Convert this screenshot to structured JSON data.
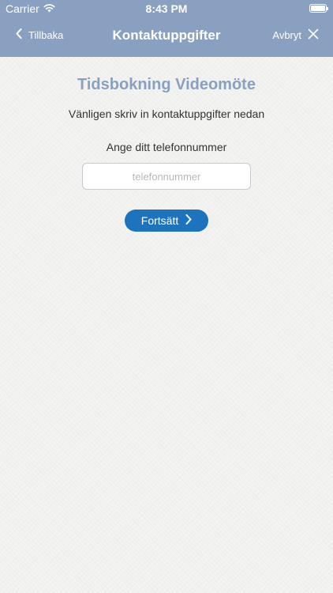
{
  "status_bar": {
    "carrier": "Carrier",
    "time": "8:43 PM",
    "battery_level": 1.0
  },
  "nav": {
    "back_label": "Tillbaka",
    "title": "Kontaktuppgifter",
    "cancel_label": "Avbryt"
  },
  "form": {
    "heading": "Tidsbokning Videomöte",
    "subtitle": "Vänligen skriv in kontaktuppgifter nedan",
    "phone_label": "Ange ditt telefonnummer",
    "phone_value": "",
    "phone_placeholder": "telefonnummer",
    "continue_label": "Fortsätt"
  },
  "colors": {
    "header_bg": "#8aa0c0",
    "accent_button": "#1d74bd",
    "heading_text": "#8aa0c0"
  },
  "icons": {
    "back": "chevron-left-icon",
    "cancel": "close-icon",
    "continue": "chevron-right-icon",
    "wifi": "wifi-icon",
    "battery": "battery-icon"
  }
}
